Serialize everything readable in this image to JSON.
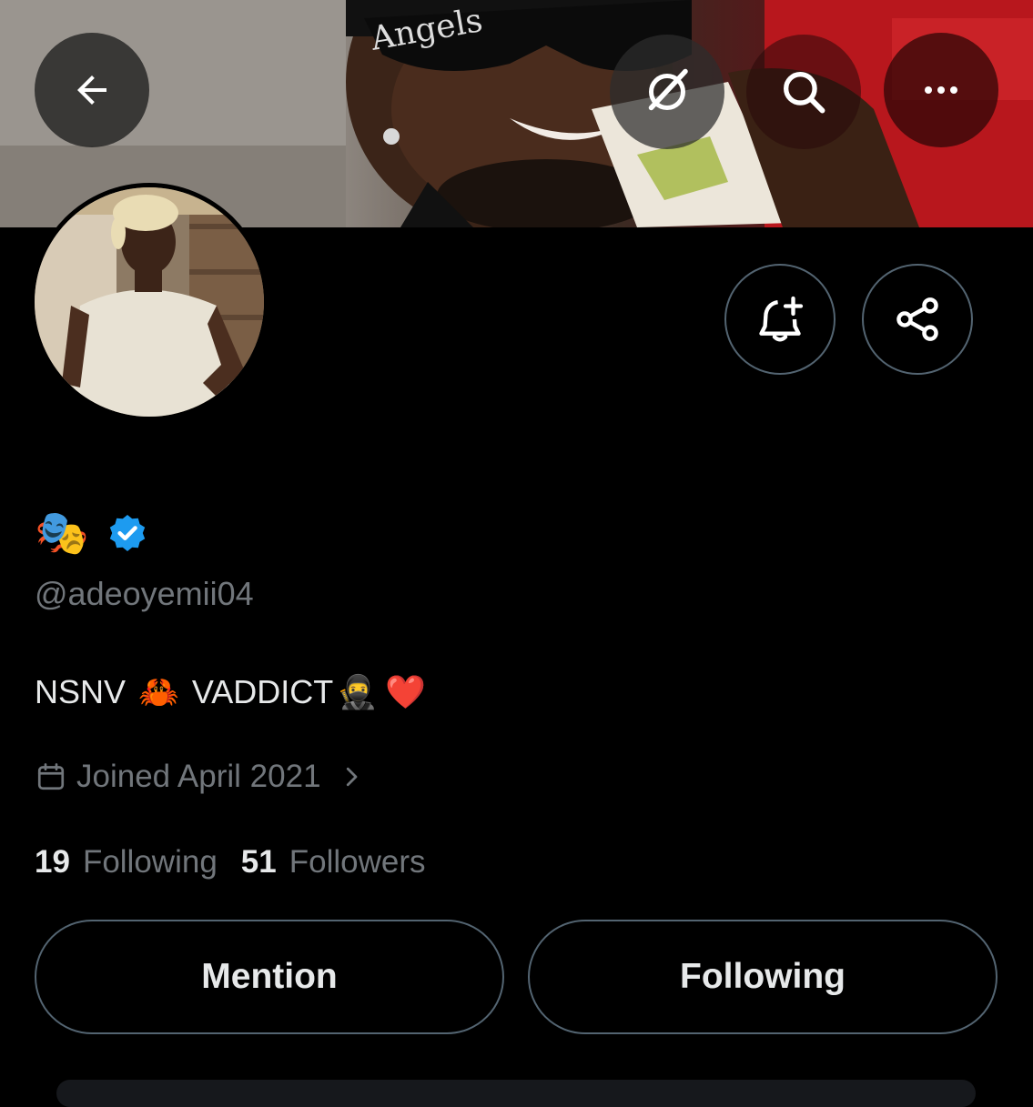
{
  "header": {
    "back_icon": "arrow-left-icon",
    "grok_icon": "grok-icon",
    "search_icon": "search-icon",
    "more_icon": "more-horizontal-icon"
  },
  "profile": {
    "name_emoji": "🎭",
    "verified_icon": "verified-badge-icon",
    "verified_color": "#1d9bf0",
    "handle": "@adeoyemii04",
    "bio": {
      "part1": "NSNV ",
      "emoji1": "🦀",
      "part2": " VADDICT",
      "emoji2": "🥷",
      "emoji3": "❤️"
    },
    "joined": "Joined April 2021",
    "following_count": "19",
    "following_label": "Following",
    "followers_count": "51",
    "followers_label": "Followers"
  },
  "actions": {
    "notify_icon": "bell-plus-icon",
    "share_icon": "share-icon",
    "mention_label": "Mention",
    "following_button_label": "Following"
  },
  "colors": {
    "background": "#000000",
    "text_primary": "#e7e9ea",
    "text_secondary": "#71767b",
    "border": "#536471",
    "accent": "#1d9bf0"
  }
}
